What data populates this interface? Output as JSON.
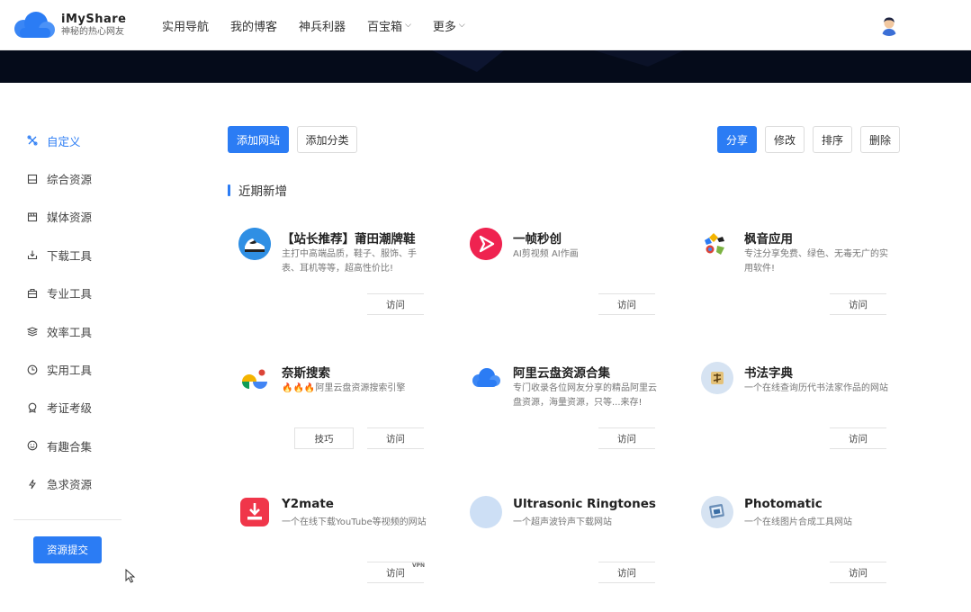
{
  "brand": {
    "title": "iMyShare",
    "subtitle": "神秘的热心网友"
  },
  "nav": [
    {
      "label": "实用导航",
      "dropdown": false
    },
    {
      "label": "我的博客",
      "dropdown": false
    },
    {
      "label": "神兵利器",
      "dropdown": false
    },
    {
      "label": "百宝箱",
      "dropdown": true
    },
    {
      "label": "更多",
      "dropdown": true
    }
  ],
  "sidebar": {
    "items": [
      {
        "label": "自定义",
        "icon": "custom-icon",
        "active": true
      },
      {
        "label": "综合资源",
        "icon": "archive-icon",
        "active": false
      },
      {
        "label": "媒体资源",
        "icon": "film-icon",
        "active": false
      },
      {
        "label": "下载工具",
        "icon": "download-icon",
        "active": false
      },
      {
        "label": "专业工具",
        "icon": "briefcase-icon",
        "active": false
      },
      {
        "label": "效率工具",
        "icon": "layers-icon",
        "active": false
      },
      {
        "label": "实用工具",
        "icon": "clock-icon",
        "active": false
      },
      {
        "label": "考证考级",
        "icon": "badge-icon",
        "active": false
      },
      {
        "label": "有趣合集",
        "icon": "smile-icon",
        "active": false
      },
      {
        "label": "急求资源",
        "icon": "bolt-icon",
        "active": false
      }
    ],
    "submit_label": "资源提交"
  },
  "toolbar": {
    "add_site": "添加网站",
    "add_category": "添加分类",
    "share": "分享",
    "edit": "修改",
    "sort": "排序",
    "delete": "删除"
  },
  "section": {
    "title": "近期新增"
  },
  "cards": [
    {
      "title": "【站长推荐】莆田潮牌鞋",
      "desc": "主打中高端品质，鞋子、服饰、手表、耳机等等，超高性价比!",
      "visit": "访问",
      "icon": "sneaker-icon"
    },
    {
      "title": "一帧秒创",
      "desc": "AI剪视频 AI作画",
      "visit": "访问",
      "icon": "yizhen-icon"
    },
    {
      "title": "枫音应用",
      "desc": "专注分享免费、绿色、无毒无广的实用软件!",
      "visit": "访问",
      "icon": "fengyin-icon"
    },
    {
      "title": "奈斯搜索",
      "desc": "🔥🔥🔥阿里云盘资源搜索引擎",
      "visit": "访问",
      "tip": "技巧",
      "icon": "naisi-icon"
    },
    {
      "title": "阿里云盘资源合集",
      "desc": "专门收录各位网友分享的精品阿里云盘资源，海量资源，只等...来存!",
      "visit": "访问",
      "icon": "cloud-icon"
    },
    {
      "title": "书法字典",
      "desc": "一个在线查询历代书法家作品的网站",
      "visit": "访问",
      "icon": "calligraphy-icon"
    },
    {
      "title": "Y2mate",
      "desc": "一个在线下载YouTube等视频的网站",
      "visit": "访问",
      "badge": "VPN",
      "icon": "y2mate-icon"
    },
    {
      "title": "Ultrasonic Ringtones",
      "desc": "一个超声波铃声下载网站",
      "visit": "访问",
      "icon": "ringtones-icon"
    },
    {
      "title": "Photomatic",
      "desc": "一个在线图片合成工具网站",
      "visit": "访问",
      "icon": "photomatic-icon"
    }
  ]
}
